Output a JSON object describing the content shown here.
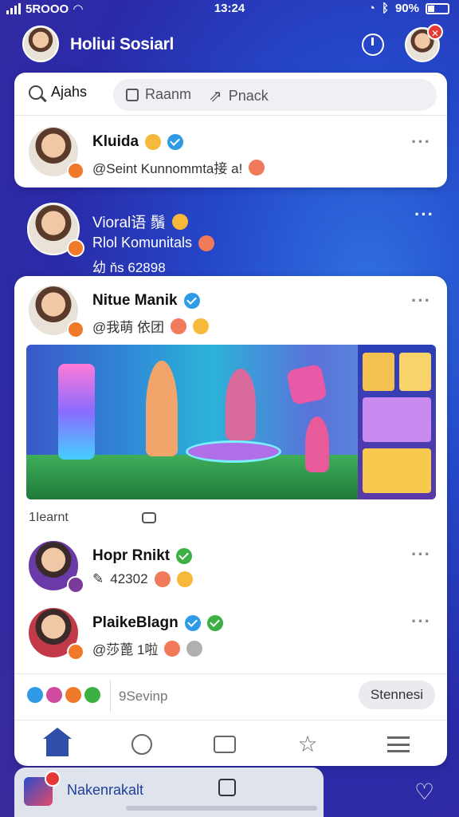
{
  "status_bar": {
    "carrier": "5ROOO",
    "time": "13:24",
    "battery": "90%"
  },
  "header": {
    "title": "Holiui Sosiarl"
  },
  "tabs": {
    "search_label": "Ajahs",
    "items": [
      {
        "label": "Raanm",
        "icon": "square-icon"
      },
      {
        "label": "Pnack",
        "icon": "share-icon"
      }
    ]
  },
  "posts": [
    {
      "name": "Kluida",
      "meta": "@Seint Kunnommta接 a!",
      "verified": true
    },
    {
      "name": "Vioral语 鬚",
      "meta": "Rlol Komunitals",
      "meta2": "幼 ňs 62898"
    },
    {
      "name": "Nitue Manik",
      "meta": "@我萌 依团",
      "verified": true
    },
    {
      "name": "Hopr Rnikt",
      "meta": "42302",
      "verified": true
    },
    {
      "name": "PlaikeBlagn",
      "meta": "@莎蓖 1啦",
      "verified": true
    }
  ],
  "feed": {
    "section_label": "1Iearnt"
  },
  "composer": {
    "placeholder": "9Sevinp",
    "button": "Stennesi"
  },
  "dock": {
    "label": "Nakenrakalt"
  },
  "colors": {
    "accent": "#2f4fa8",
    "background": "#2448c9",
    "badge_orange": "#f07a2a",
    "verified": "#2f9be6"
  }
}
